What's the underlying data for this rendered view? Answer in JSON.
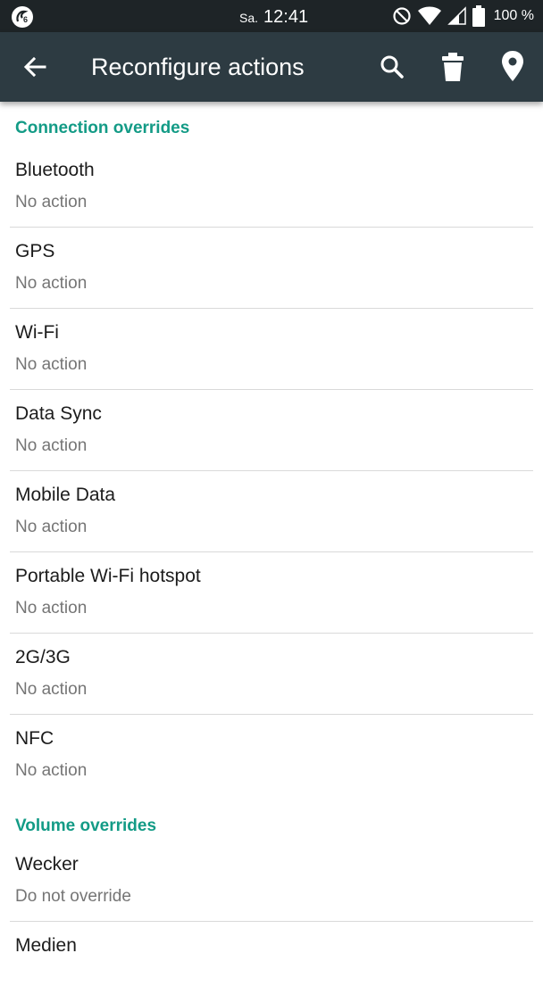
{
  "status_bar": {
    "day": "Sa.",
    "time": "12:41",
    "battery": "100 %",
    "icons": [
      "app-notification-icon",
      "do-not-disturb-icon",
      "wifi-icon",
      "signal-icon",
      "battery-icon"
    ]
  },
  "toolbar": {
    "title": "Reconfigure actions",
    "icons": [
      "back-arrow-icon",
      "search-icon",
      "trash-icon",
      "place-icon"
    ],
    "background": "#2d3b42"
  },
  "accent": "#139b86",
  "sections": [
    {
      "header": "Connection overrides",
      "items": [
        {
          "title": "Bluetooth",
          "subtitle": "No action"
        },
        {
          "title": "GPS",
          "subtitle": "No action"
        },
        {
          "title": "Wi-Fi",
          "subtitle": "No action"
        },
        {
          "title": "Data Sync",
          "subtitle": "No action"
        },
        {
          "title": "Mobile Data",
          "subtitle": "No action"
        },
        {
          "title": "Portable Wi-Fi hotspot",
          "subtitle": "No action"
        },
        {
          "title": "2G/3G",
          "subtitle": "No action"
        },
        {
          "title": "NFC",
          "subtitle": "No action"
        }
      ]
    },
    {
      "header": "Volume overrides",
      "items": [
        {
          "title": "Wecker",
          "subtitle": "Do not override"
        },
        {
          "title": "Medien",
          "subtitle": ""
        }
      ]
    }
  ]
}
